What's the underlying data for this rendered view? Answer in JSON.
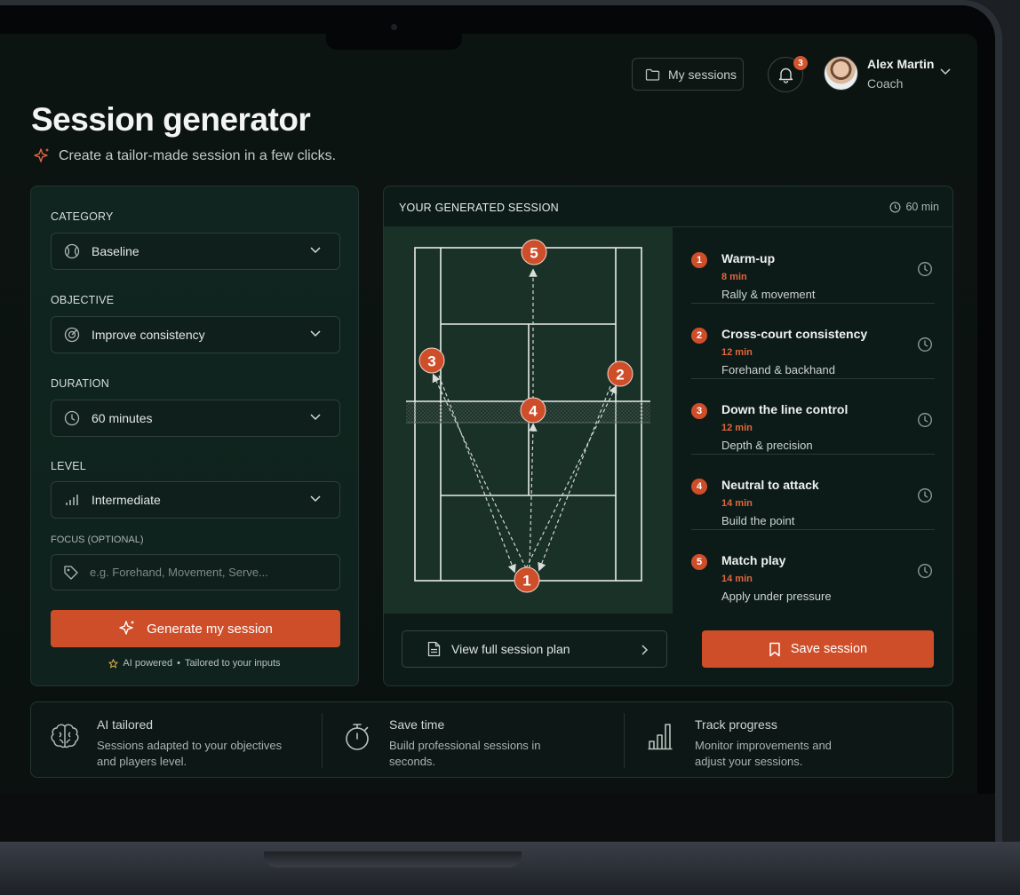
{
  "header": {
    "sessions_label": "My sessions",
    "notifications_count": "3",
    "user_name": "Alex Martin",
    "user_role": "Coach"
  },
  "page": {
    "title": "Session generator",
    "subtitle": "Create a tailor-made session in a few clicks."
  },
  "form": {
    "category_label": "CATEGORY",
    "category_value": "Baseline",
    "objective_label": "OBJECTIVE",
    "objective_value": "Improve consistency",
    "duration_label": "DURATION",
    "duration_value": "60 minutes",
    "level_label": "LEVEL",
    "level_value": "Intermediate",
    "focus_label": "FOCUS (OPTIONAL)",
    "focus_placeholder": "e.g. Forehand, Movement, Serve...",
    "generate_label": "Generate my session",
    "ai_note_1": "AI powered",
    "ai_note_sep": "•",
    "ai_note_2": "Tailored to your inputs"
  },
  "session": {
    "title": "YOUR GENERATED SESSION",
    "duration": "60 min",
    "court_markers": [
      "1",
      "2",
      "3",
      "4",
      "5"
    ],
    "drills": [
      {
        "num": "1",
        "name": "Warm-up",
        "time": "8 min",
        "desc": "Rally & movement"
      },
      {
        "num": "2",
        "name": "Cross-court consistency",
        "time": "12 min",
        "desc": "Forehand & backhand"
      },
      {
        "num": "3",
        "name": "Down the line control",
        "time": "12 min",
        "desc": "Depth & precision"
      },
      {
        "num": "4",
        "name": "Neutral to attack",
        "time": "14 min",
        "desc": "Build the point"
      },
      {
        "num": "5",
        "name": "Match play",
        "time": "14 min",
        "desc": "Apply under pressure"
      }
    ],
    "view_plan_label": "View full session plan",
    "save_label": "Save session"
  },
  "features": [
    {
      "title": "AI tailored",
      "desc_1": "Sessions adapted to your objectives",
      "desc_2": "and players level.",
      "icon": "brain-icon"
    },
    {
      "title": "Save time",
      "desc_1": "Build professional sessions in",
      "desc_2": "seconds.",
      "icon": "stopwatch-icon"
    },
    {
      "title": "Track progress",
      "desc_1": "Monitor improvements and",
      "desc_2": "adjust your sessions.",
      "icon": "bar-chart-icon"
    }
  ],
  "colors": {
    "accent": "#cf4e2a",
    "background": "#0b1210",
    "panel": "#102520",
    "court": "#1a3128"
  }
}
